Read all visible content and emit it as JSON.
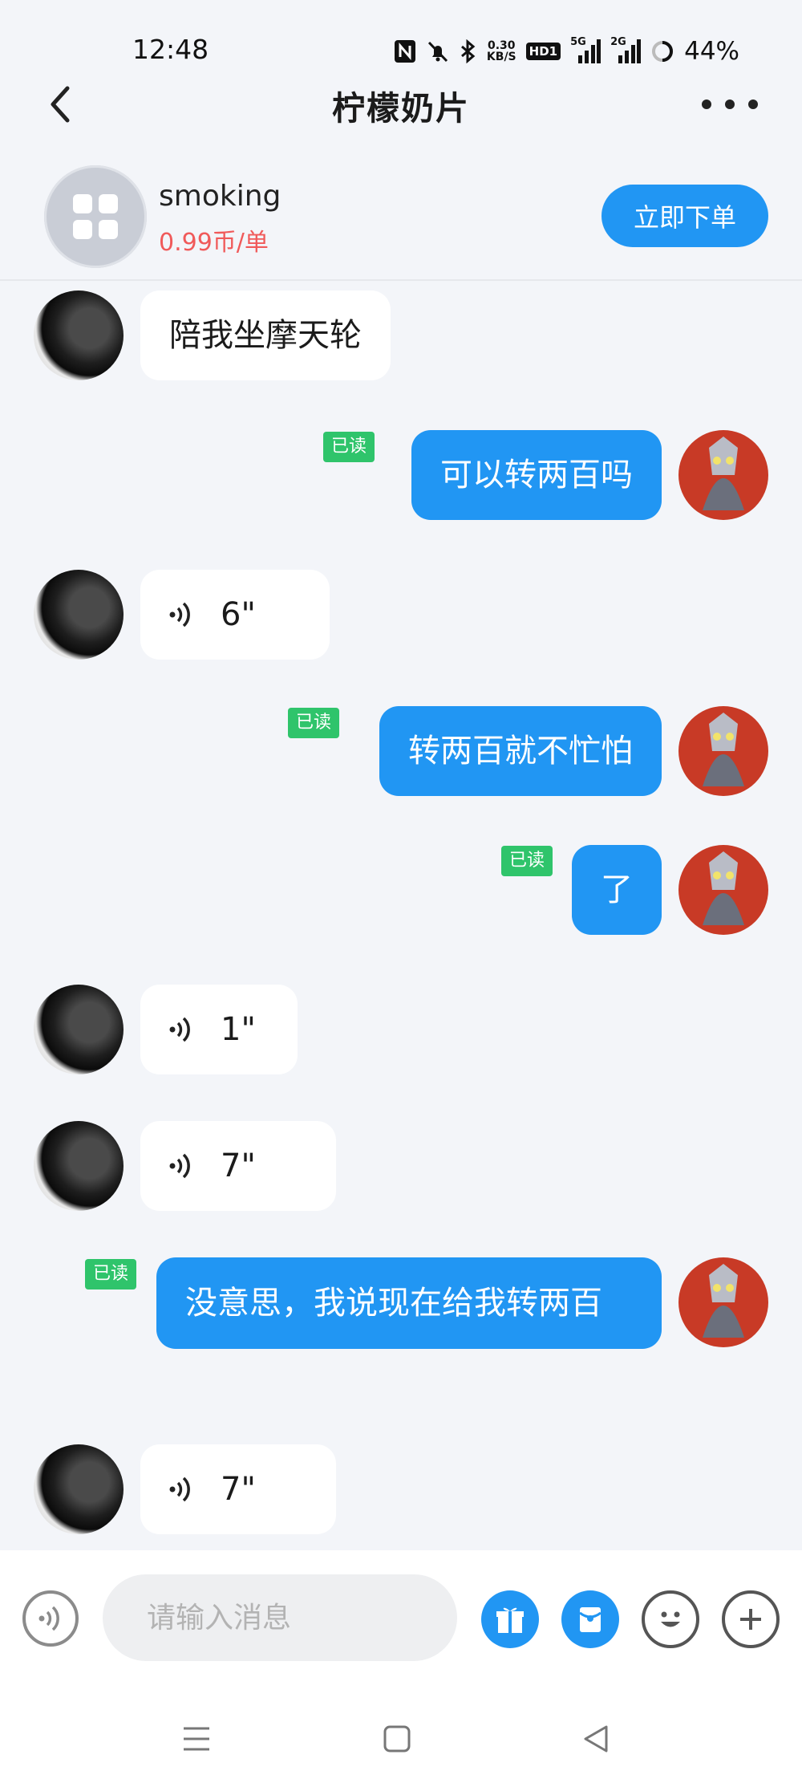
{
  "status_bar": {
    "time": "12:48",
    "net_speed_value": "0.30",
    "net_speed_unit": "KB/S",
    "hd_label": "HD1",
    "signal_1_label": "5G",
    "signal_2_label": "2G",
    "battery": "44%"
  },
  "header": {
    "title": "柠檬奶片"
  },
  "order_bar": {
    "service_name": "smoking",
    "price": "0.99币/单",
    "order_button": "立即下单"
  },
  "messages": [
    {
      "side": "in",
      "type": "text",
      "text": "陪我坐摩天轮"
    },
    {
      "side": "out",
      "type": "text",
      "text": "可以转两百吗",
      "read": "已读"
    },
    {
      "side": "in",
      "type": "voice",
      "duration": "6\""
    },
    {
      "side": "out",
      "type": "text",
      "text": "转两百就不忙怕",
      "read": "已读"
    },
    {
      "side": "out",
      "type": "text",
      "text": "了",
      "read": "已读"
    },
    {
      "side": "in",
      "type": "voice",
      "duration": "1\""
    },
    {
      "side": "in",
      "type": "voice",
      "duration": "7\""
    },
    {
      "side": "out",
      "type": "text",
      "text": "没意思，我说现在给我转两百",
      "read": "已读"
    },
    {
      "side": "in",
      "type": "voice",
      "duration": "7\""
    }
  ],
  "input_bar": {
    "placeholder": "请输入消息"
  },
  "colors": {
    "accent": "#2196f3",
    "read_badge": "#2fc46b",
    "price": "#f05a5a",
    "background": "#f3f5f9"
  },
  "icons": [
    "back-icon",
    "more-icon",
    "service-icon",
    "voice-icon",
    "gift-icon",
    "red-packet-icon",
    "emoji-icon",
    "plus-icon",
    "menu-nav-icon",
    "home-nav-icon",
    "back-nav-icon"
  ]
}
